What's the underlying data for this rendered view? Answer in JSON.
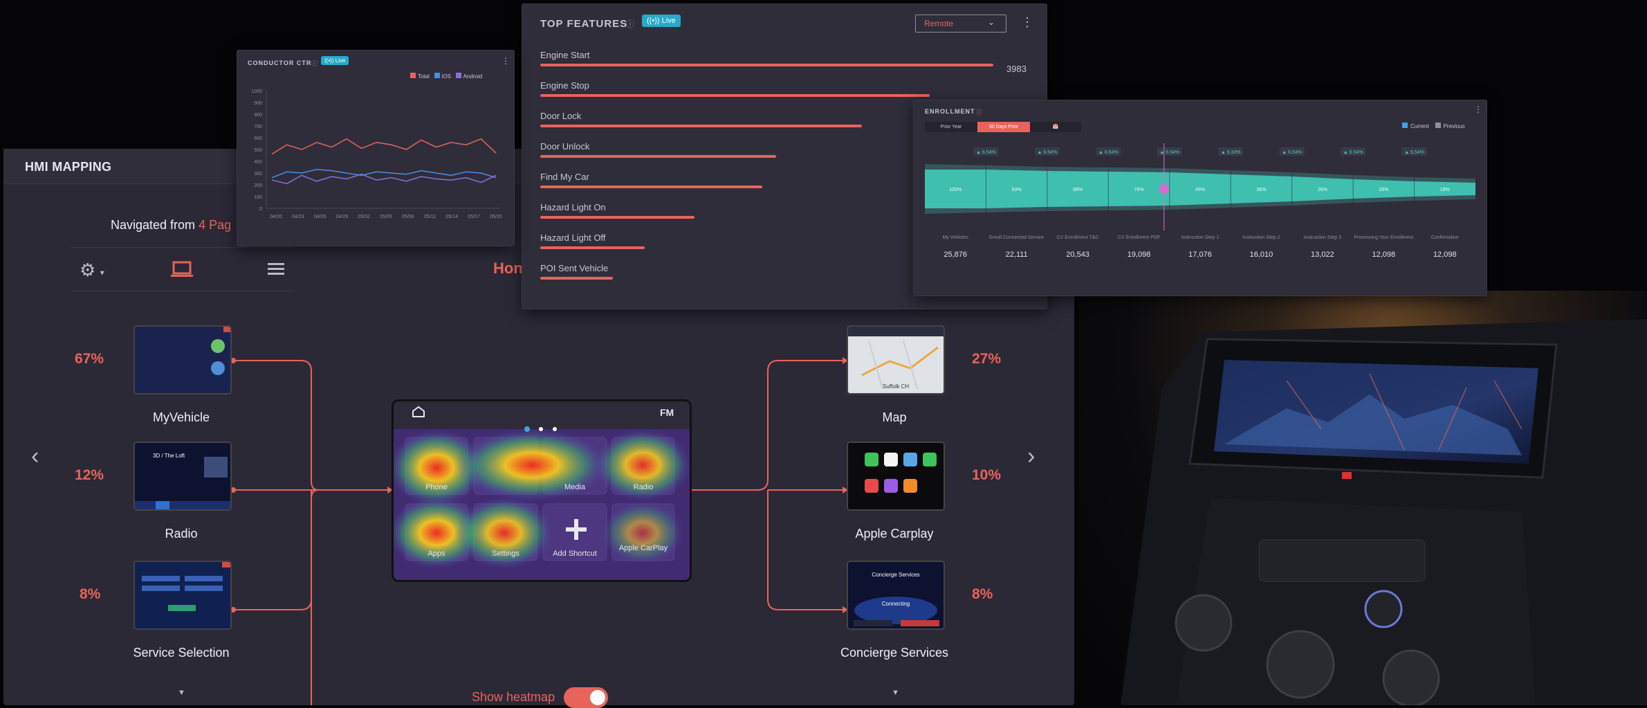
{
  "hmi": {
    "title": "HMI MAPPING",
    "navigated_prefix": "Navigated from",
    "navigated_value": "4 Pag",
    "home_tab": "Hon",
    "left_screens": [
      {
        "pct": "67%",
        "label": "MyVehicle"
      },
      {
        "pct": "12%",
        "label": "Radio"
      },
      {
        "pct": "8%",
        "label": "Service Selection"
      }
    ],
    "right_screens": [
      {
        "pct": "27%",
        "label": "Map"
      },
      {
        "pct": "10%",
        "label": "Apple Carplay"
      },
      {
        "pct": "8%",
        "label": "Concierge Services"
      }
    ],
    "center_screen": {
      "fm": "FM",
      "tiles": [
        "Phone",
        "",
        "Media",
        "Radio",
        "Apps",
        "Settings",
        "Add Shortcut",
        "Apple CarPlay"
      ]
    },
    "heatmap_label": "Show heatmap",
    "heatmap_on": true,
    "thumb_texts": {
      "radio_station": "3D / The Loft",
      "concierge_title": "Concierge Services",
      "concierge_status": "Connecting",
      "map_place": "Suffolk CH"
    }
  },
  "top_features": {
    "title": "TOP FEATURES",
    "live": "Live",
    "dropdown": "Remote",
    "accent": "#e8645a",
    "first_value": "3983",
    "items": [
      {
        "label": "Engine Start",
        "value": 1.0
      },
      {
        "label": "Engine Stop",
        "value": 0.86
      },
      {
        "label": "Door Lock",
        "value": 0.71
      },
      {
        "label": "Door Unlock",
        "value": 0.52
      },
      {
        "label": "Find My Car",
        "value": 0.49
      },
      {
        "label": "Hazard Light On",
        "value": 0.34
      },
      {
        "label": "Hazard Light Off",
        "value": 0.23
      },
      {
        "label": "POI Sent Vehicle",
        "value": 0.16
      }
    ]
  },
  "conductor": {
    "title": "CONDUCTOR CTR",
    "live": "Live",
    "legend": [
      {
        "name": "Total",
        "color": "#e8645a"
      },
      {
        "name": "iOS",
        "color": "#4c8de3"
      },
      {
        "name": "Android",
        "color": "#8b6ee0"
      }
    ],
    "y_ticks": [
      "1000",
      "900",
      "800",
      "700",
      "600",
      "500",
      "400",
      "300",
      "200",
      "100",
      "0"
    ],
    "x_ticks": [
      "04/20",
      "04/23",
      "04/26",
      "04/29",
      "05/02",
      "05/05",
      "05/08",
      "05/11",
      "05/14",
      "05/17",
      "05/20"
    ]
  },
  "chart_data": {
    "type": "line",
    "x": [
      "04/20",
      "04/22",
      "04/24",
      "04/26",
      "04/28",
      "04/30",
      "05/02",
      "05/04",
      "05/06",
      "05/08",
      "05/10",
      "05/12",
      "05/14",
      "05/16",
      "05/18",
      "05/20"
    ],
    "ylim": [
      0,
      1000
    ],
    "series": [
      {
        "name": "Total",
        "values": [
          460,
          540,
          500,
          560,
          520,
          590,
          510,
          560,
          540,
          500,
          580,
          520,
          560,
          540,
          590,
          470
        ]
      },
      {
        "name": "iOS",
        "values": [
          260,
          310,
          300,
          330,
          320,
          300,
          280,
          310,
          300,
          290,
          320,
          300,
          280,
          310,
          300,
          260
        ]
      },
      {
        "name": "Android",
        "values": [
          240,
          210,
          280,
          230,
          270,
          250,
          290,
          240,
          260,
          230,
          270,
          250,
          240,
          260,
          220,
          280
        ]
      }
    ]
  },
  "enrollment": {
    "title": "ENROLLMENT",
    "tabs": [
      "Prior Year",
      "30 Days Prior",
      "📅"
    ],
    "legend": [
      "Current",
      "Previous"
    ],
    "chips": [
      "6.54%",
      "6.54%",
      "6.54%",
      "6.54%",
      "6.33%",
      "6.54%",
      "6.54%",
      "6.54%"
    ],
    "stages": [
      {
        "label": "My Vehicles",
        "pct": "100%",
        "value": "25,876"
      },
      {
        "label": "Enroll Connected Service",
        "pct": "93%",
        "value": "22,111"
      },
      {
        "label": "CV Enrollment T&C",
        "pct": "88%",
        "value": "20,543"
      },
      {
        "label": "CV Enrollment PSP",
        "pct": "76%",
        "value": "19,098"
      },
      {
        "label": "Instruction Step 1",
        "pct": "45%",
        "value": "17,076"
      },
      {
        "label": "Instruction Step 2",
        "pct": "36%",
        "value": "16,010"
      },
      {
        "label": "Instruction Step 3",
        "pct": "26%",
        "value": "13,022"
      },
      {
        "label": "Processing Your Enrollment",
        "pct": "26%",
        "value": "12,098"
      },
      {
        "label": "Confirmation",
        "pct": "18%",
        "value": "12,098"
      }
    ],
    "marker": "76%"
  }
}
